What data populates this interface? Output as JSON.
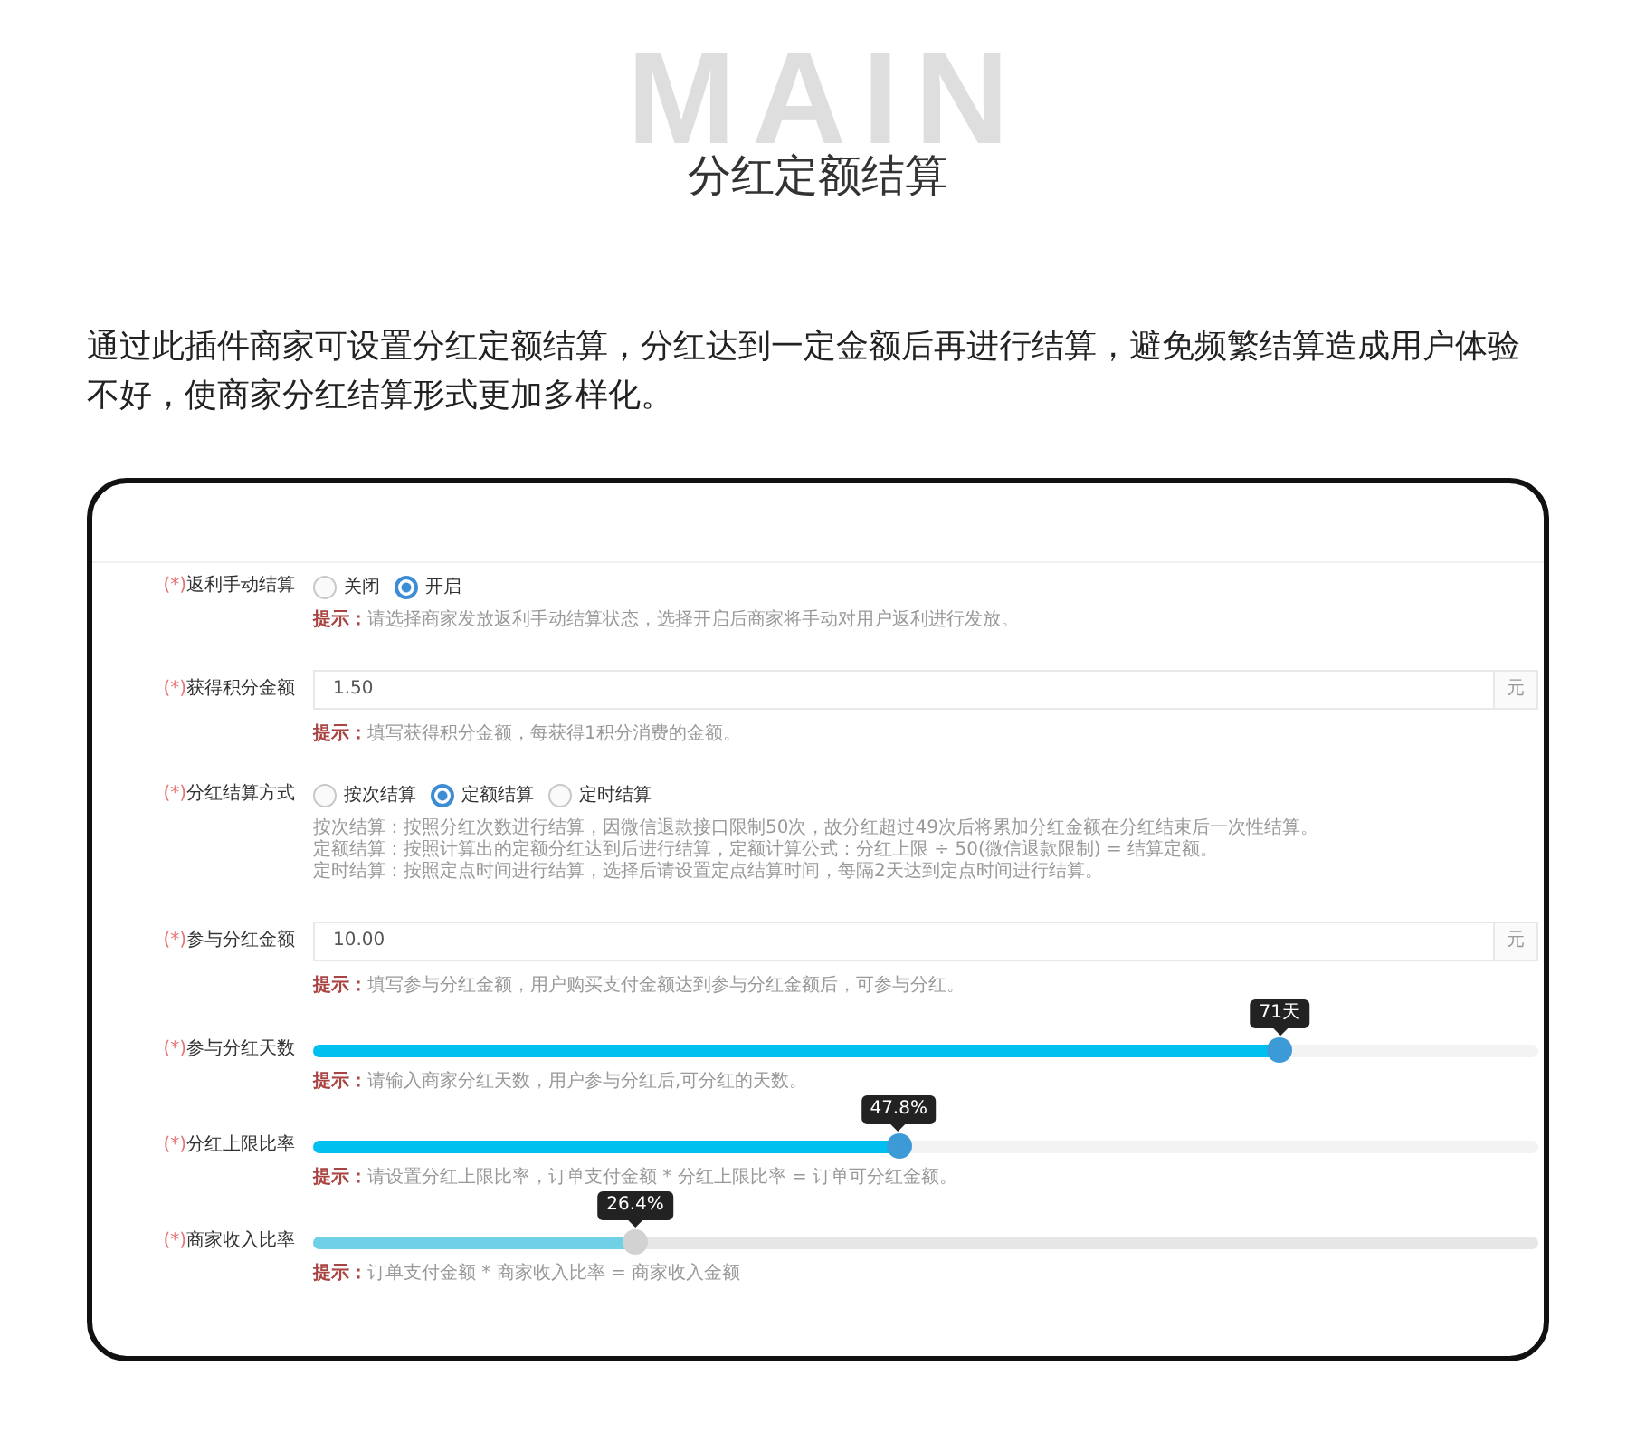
{
  "backdrop_word": "MAIN",
  "title": "分红定额结算",
  "description": "通过此插件商家可设置分红定额结算，分红达到一定金额后再进行结算，避免频繁结算造成用户体验不好，使商家分红结算形式更加多样化。",
  "form": {
    "fields": [
      {
        "kind": "radio",
        "mark": "(*)",
        "label": "返利手动结算",
        "options": [
          {
            "label": "关闭",
            "selected": false
          },
          {
            "label": "开启",
            "selected": true
          }
        ],
        "hint_label": "提示：",
        "hint": "请选择商家发放返利手动结算状态，选择开启后商家将手动对用户返利进行发放。"
      },
      {
        "kind": "input",
        "mark": "(*)",
        "label": "获得积分金额",
        "value": "1.50",
        "unit": "元",
        "hint_label": "提示：",
        "hint": "填写获得积分金额，每获得1积分消费的金额。"
      },
      {
        "kind": "radio",
        "mark": "(*)",
        "label": "分红结算方式",
        "options": [
          {
            "label": "按次结算",
            "selected": false
          },
          {
            "label": "定额结算",
            "selected": true
          },
          {
            "label": "定时结算",
            "selected": false
          }
        ],
        "notes": [
          "按次结算：按照分红次数进行结算，因微信退款接口限制50次，故分红超过49次后将累加分红金额在分红结束后一次性结算。",
          "定额结算：按照计算出的定额分红达到后进行结算，定额计算公式：分红上限 ÷ 50(微信退款限制) = 结算定额。",
          "定时结算：按照定点时间进行结算，选择后请设置定点结算时间，每隔2天达到定点时间进行结算。"
        ]
      },
      {
        "kind": "input",
        "mark": "(*)",
        "label": "参与分红金额",
        "value": "10.00",
        "unit": "元",
        "hint_label": "提示：",
        "hint": "填写参与分红金额，用户购买支付金额达到参与分红金额后，可参与分红。"
      },
      {
        "kind": "slider",
        "mark": "(*)",
        "label": "参与分红天数",
        "level": 0.789,
        "reading": "71天",
        "disabled": false,
        "hint_label": "提示：",
        "hint": "请输入商家分红天数，用户参与分红后,可分红的天数。"
      },
      {
        "kind": "slider",
        "mark": "(*)",
        "label": "分红上限比率",
        "level": 0.478,
        "reading": "47.8%",
        "disabled": false,
        "hint_label": "提示：",
        "hint": "请设置分红上限比率，订单支付金额 * 分红上限比率 = 订单可分红金额。"
      },
      {
        "kind": "slider",
        "mark": "(*)",
        "label": "商家收入比率",
        "level": 0.263,
        "reading": "26.4%",
        "disabled": true,
        "hint_label": "提示：",
        "hint": "订单支付金额 * 商家收入比率 = 商家收入金额"
      }
    ]
  }
}
